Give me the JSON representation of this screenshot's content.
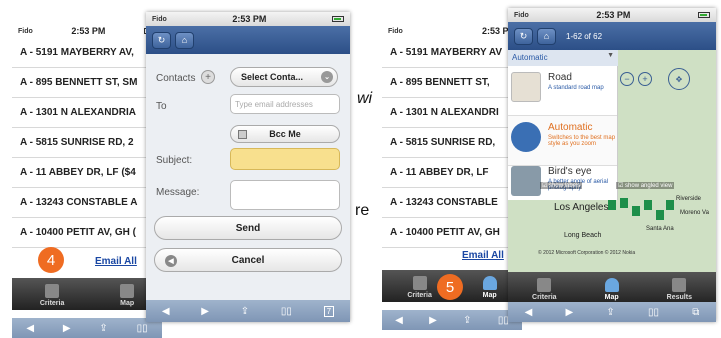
{
  "left_phone": {
    "carrier": "Fido",
    "time": "2:53 PM",
    "addresses": [
      "A - 5191 MAYBERRY AV,",
      "A - 895 BENNETT ST, SM",
      "A - 1301 N ALEXANDRIA",
      "A - 5815 SUNRISE RD, 2",
      "A - 11 ABBEY DR, LF ($4",
      "A - 13243 CONSTABLE A",
      "A - 10400 PETIT AV, GH ("
    ],
    "email_all": "Email All",
    "tabs": [
      "Criteria",
      "Map"
    ],
    "step_badge": "4"
  },
  "email_form": {
    "carrier": "Fido",
    "time": "2:53 PM",
    "contacts_label": "Contacts",
    "contacts_select": "Select Conta...",
    "to_label": "To",
    "to_placeholder": "Type email addresses",
    "bcc_label": "Bcc Me",
    "subject_label": "Subject:",
    "message_label": "Message:",
    "send_label": "Send",
    "cancel_label": "Cancel",
    "tab_badge": "7"
  },
  "stray_text": {
    "wi": "wi",
    "re": "re"
  },
  "right_phone": {
    "carrier": "Fido",
    "time": "2:53 PM",
    "addresses": [
      "A - 5191 MAYBERRY AV",
      "A - 895 BENNETT ST,",
      "A - 1301 N ALEXANDRI",
      "A - 5815 SUNRISE RD,",
      "A - 11 ABBEY DR, LF",
      "A - 13243 CONSTABLE",
      "A - 10400 PETIT AV, GH"
    ],
    "email_all": "Email All",
    "tabs": [
      "Criteria",
      "Map"
    ],
    "step_badge": "5"
  },
  "map_phone": {
    "carrier": "Fido",
    "time": "2:53 PM",
    "page_count": "1-62 of 62",
    "map_style_selected": "Automatic",
    "options": [
      {
        "title": "Road",
        "desc": "A standard road map"
      },
      {
        "title": "Automatic",
        "desc": "Switches to the best map style as you zoom"
      },
      {
        "title": "Bird's eye",
        "desc": "A better angle of aerial photography"
      }
    ],
    "show_labels": "show labels",
    "show_angled": "show angled view",
    "map_labels": {
      "los_angeles": "Los Angeles",
      "riverside": "Riverside",
      "moreno": "Moreno Va",
      "long_beach": "Long Beach",
      "santa_ana": "Santa Ana",
      "copyright": "© 2012 Microsoft Corporation  © 2012 Nokia"
    },
    "tabs": [
      "Criteria",
      "Map",
      "Results"
    ]
  },
  "colors": {
    "nav_blue": "#2c4f87",
    "badge_orange": "#ef6c22",
    "link_blue": "#1a47a3",
    "subject_yellow": "#f8e08e"
  }
}
